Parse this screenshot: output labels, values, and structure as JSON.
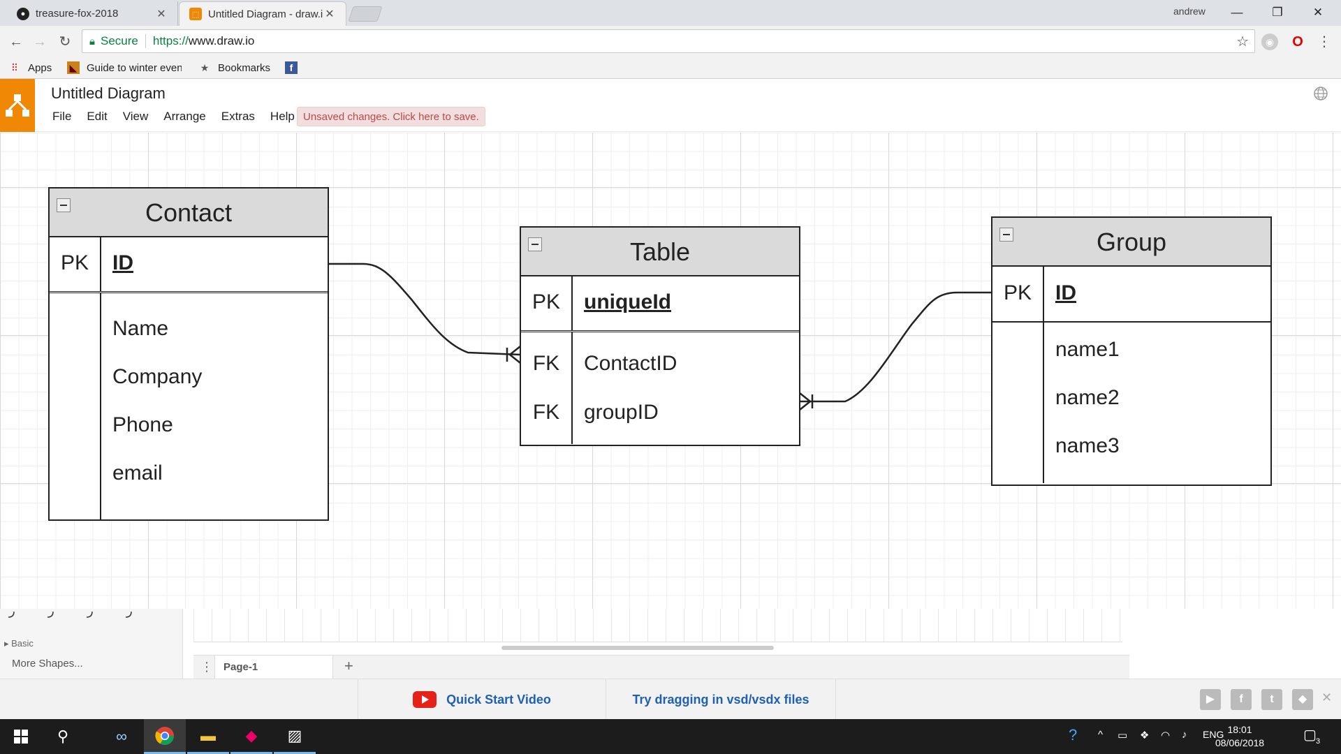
{
  "browser": {
    "tabs": [
      {
        "title": "treasure-fox-2018",
        "active": false
      },
      {
        "title": "Untitled Diagram - draw.io",
        "active": true
      }
    ],
    "profile_name": "andrew",
    "address": {
      "secure_label": "Secure",
      "scheme": "https://",
      "host": "www.draw.io"
    },
    "bookmarks": [
      {
        "label": "Apps",
        "icon": "apps-grid-icon"
      },
      {
        "label": "Guide to winter even",
        "icon": "site-icon"
      },
      {
        "label": "Bookmarks",
        "icon": "star-icon"
      },
      {
        "label": "",
        "icon": "facebook-icon"
      }
    ]
  },
  "app": {
    "doc_title": "Untitled Diagram",
    "menus": [
      "File",
      "Edit",
      "View",
      "Arrange",
      "Extras",
      "Help"
    ],
    "unsaved_notice": "Unsaved changes. Click here to save."
  },
  "diagram": {
    "entities": [
      {
        "name": "Contact",
        "pk_label": "PK",
        "pk_field": "ID",
        "fields": [
          "Name",
          "Company",
          "Phone",
          "email"
        ]
      },
      {
        "name": "Table",
        "pk_label": "PK",
        "pk_field": "uniqueId",
        "fk": [
          {
            "label": "FK",
            "field": "ContactID"
          },
          {
            "label": "FK",
            "field": "groupID"
          }
        ]
      },
      {
        "name": "Group",
        "pk_label": "PK",
        "pk_field": "ID",
        "fields": [
          "name1",
          "name2",
          "name3"
        ]
      }
    ],
    "relations": [
      {
        "from": "Contact.ID",
        "to": "Table.ContactID",
        "notation": "one-to-many"
      },
      {
        "from": "Group.ID",
        "to": "Table.groupID",
        "notation": "one-to-many"
      }
    ]
  },
  "sidebar": {
    "section": "Basic",
    "more_shapes": "More Shapes..."
  },
  "pages": {
    "current": "Page-1"
  },
  "footer": {
    "video_label": "Quick Start Video",
    "vsdx_label": "Try dragging in vsd/vsdx files"
  },
  "taskbar": {
    "language": "ENG",
    "time": "18:01",
    "date": "08/06/2018",
    "notifications": "3"
  }
}
